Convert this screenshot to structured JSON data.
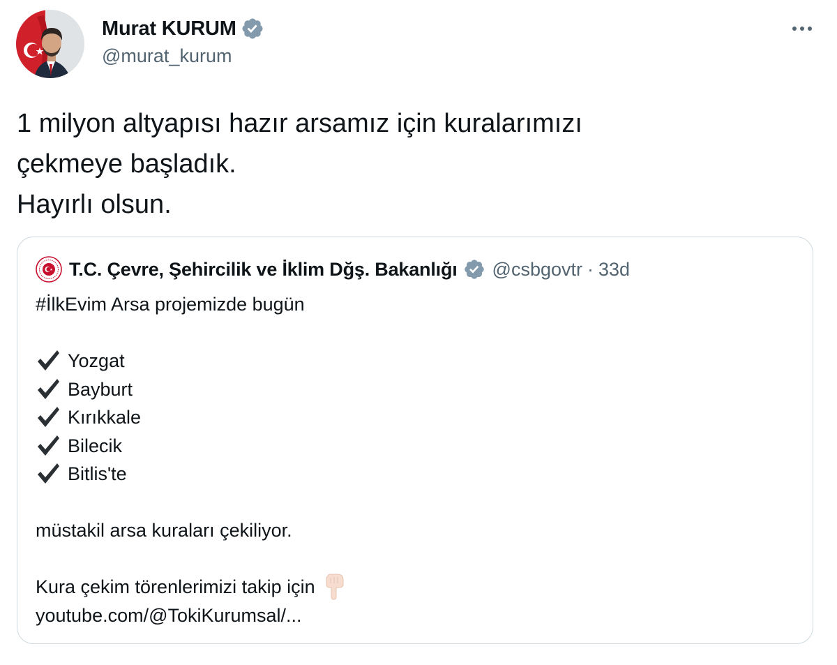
{
  "author": {
    "name": "Murat KURUM",
    "handle": "@murat_kurum",
    "verified_icon": "verified-badge-icon",
    "verified_color": "#829aab"
  },
  "tweet": {
    "lines": [
      "1 milyon altyapısı hazır arsamız için kuralarımızı",
      "çekmeye başladık.",
      "Hayırlı olsun."
    ]
  },
  "quote": {
    "name": "T.C. Çevre, Şehircilik ve İklim Dğş. Bakanlığı",
    "handle": "@csbgovtr",
    "separator": "·",
    "time": "33d",
    "intro": "#İlkEvim Arsa projemizde bugün",
    "cities": [
      "Yozgat",
      "Bayburt",
      "Kırıkkale",
      "Bilecik",
      "Bitlis'te"
    ],
    "statement": "müstakil arsa kuraları çekiliyor.",
    "follow_text": "Kura çekim törenlerimizi takip için",
    "link": "youtube.com/@TokiKurumsal/..."
  },
  "colors": {
    "text": "#0f1419",
    "secondary": "#536471",
    "border": "#cfd9de",
    "ministry_red": "#c8102e"
  },
  "icons": {
    "more": "more-options-icon",
    "check": "check-mark-icon",
    "pointing": "backhand-index-pointing-down-icon"
  }
}
